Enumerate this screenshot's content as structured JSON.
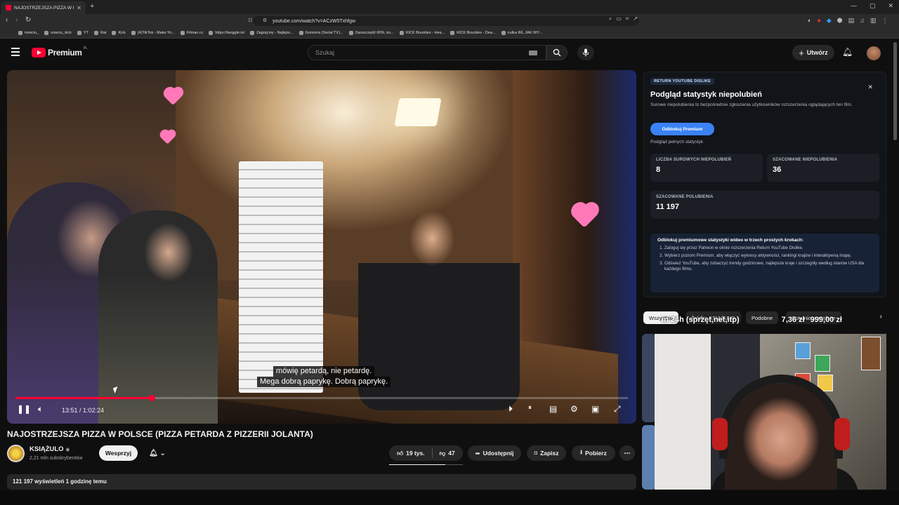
{
  "browser": {
    "tab_title": "NAJOSTRZEJSZA PIZZA W PO",
    "url": "youtube.com/watch?v=ACzW5Txhfgw",
    "bookmarks": [
      "nowciu_",
      "nowciu_kick",
      "YT",
      "Rat",
      "Kick",
      "(4)TikTok - Make Yo...",
      "Filman.cc",
      "https://tanggle.io/",
      "Zagraj.my - Najleps...",
      "Gomorra (Serial TV)...",
      "Zaoszczędź 60%, ko...",
      "KICK Bounties - Hea...",
      "KICK Bounties - Dea...",
      "nutka IRL JAK WY..."
    ]
  },
  "header": {
    "logo_text": "Premium",
    "logo_region": "PL",
    "search_placeholder": "Szukaj",
    "create_label": "Utwórz"
  },
  "player": {
    "captions": [
      "mówię petardą, nie petardę.",
      "Mega dobrą paprykę. Dobrą paprykę."
    ],
    "time": "13:51 / 1:02:24",
    "progress_fraction": 0.222
  },
  "video": {
    "title": "NAJOSTRZEJSZA PIZZA W POLSCE (PIZZA PETARDA Z PIZZERII JOLANTA)",
    "channel": "KSIĄŻULO",
    "subscribers": "2,21 mln subskrybentów",
    "support_label": "Wesprzyj",
    "likes": "19 tys.",
    "dislikes": "47",
    "share_label": "Udostępnij",
    "save_label": "Zapisz",
    "download_label": "Pobierz",
    "views_line": "121 197 wyświetleń  1 godzinę temu"
  },
  "ryd": {
    "badge": "RETURN YOUTUBE DISLIKE",
    "title": "Podgląd statystyk niepolubień",
    "subtitle": "Surowe niepolubienia to bezpośrednie zgłoszenia użytkowników rozszerzenia oglądających ten film.",
    "unlock_label": "Odblokuj Premium",
    "full_stats_link": "Podgląd pełnych statystyk",
    "stats": [
      {
        "label": "LICZBA SUROWYCH NIEPOLUBIEŃ",
        "value": "8"
      },
      {
        "label": "SZACOWANE NIEPOLUBIENIA",
        "value": "36"
      },
      {
        "label": "SZACOWANE POLUBIENIA",
        "value": "11 197"
      }
    ],
    "steps_heading": "Odblokuj premiumowe statystyki wideo w trzech prostych krokach:",
    "steps": [
      "Zaloguj się przez Patreon w oknie rozszerzenia Return YouTube Dislike.",
      "Wybierz poziom Premium, aby włączyć wykresy aktywności, rankingi krajów i interaktywną mapę.",
      "Odśwież YouTube, aby zobaczyć trendy godzinowe, najlepsze kraje i szczegóły według stanów USA dla każdego filmu."
    ]
  },
  "chips": [
    "Wszystkie",
    "Źródło: KSIĄŻULO",
    "Podobne",
    "Ostatnio przesłane"
  ],
  "ticker": [
    "in 24h (sprzęt,net,itp)",
    "7,36 zł",
    "999,00 zł"
  ]
}
